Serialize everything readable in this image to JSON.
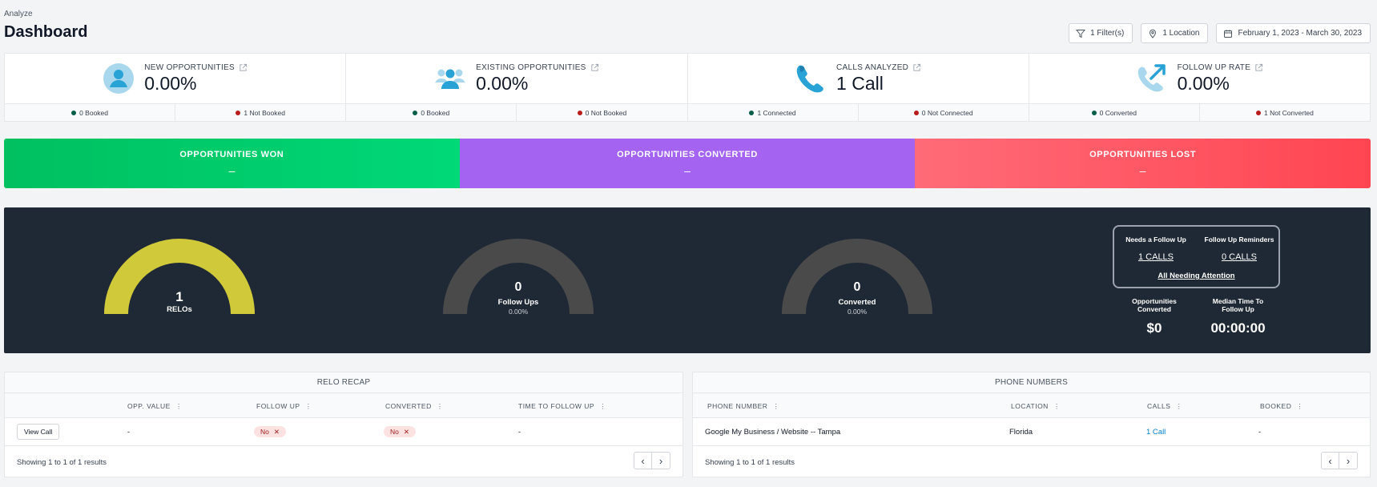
{
  "header": {
    "breadcrumb": "Analyze",
    "title": "Dashboard",
    "filters": [
      {
        "label": "1 Filter(s)",
        "icon": "filter-icon"
      },
      {
        "label": "1 Location",
        "icon": "map-pin-icon"
      },
      {
        "label": "February 1, 2023 - March 30, 2023",
        "icon": "calendar-icon"
      }
    ]
  },
  "stats": [
    {
      "label": "NEW OPPORTUNITIES",
      "value": "0.00%",
      "icon": "user-icon",
      "left": "0 Booked",
      "right": "1 Not Booked"
    },
    {
      "label": "EXISTING OPPORTUNITIES",
      "value": "0.00%",
      "icon": "users-icon",
      "left": "0 Booked",
      "right": "0 Not Booked"
    },
    {
      "label": "CALLS ANALYZED",
      "value": "1 Call",
      "icon": "phone-icon",
      "left": "1 Connected",
      "right": "0 Not Connected"
    },
    {
      "label": "FOLLOW UP RATE",
      "value": "0.00%",
      "icon": "phone-outgoing-icon",
      "left": "0 Converted",
      "right": "1 Not Converted"
    }
  ],
  "banners": {
    "won": {
      "title": "OPPORTUNITIES WON",
      "value": "–"
    },
    "converted": {
      "title": "OPPORTUNITIES CONVERTED",
      "value": "–"
    },
    "lost": {
      "title": "OPPORTUNITIES LOST",
      "value": "–"
    }
  },
  "gauges": {
    "relos": {
      "value": "1",
      "label": "RELOs",
      "fill": 1.0,
      "color": "#d0c93a"
    },
    "followups": {
      "value": "0",
      "label": "Follow Ups",
      "pct": "0.00%",
      "fill": 0.0,
      "color": "#4a4a4a"
    },
    "converted": {
      "value": "0",
      "label": "Converted",
      "pct": "0.00%",
      "fill": 0.0,
      "color": "#4a4a4a"
    }
  },
  "follow_box": {
    "needs_label": "Needs a Follow Up",
    "needs_value": "1 CALLS",
    "reminders_label": "Follow Up Reminders",
    "reminders_value": "0 CALLS",
    "all_link": "All Needing Attention"
  },
  "metrics": {
    "opps_converted_label_1": "Opportunities",
    "opps_converted_label_2": "Converted",
    "opps_converted_value": "$0",
    "median_label_1": "Median Time To",
    "median_label_2": "Follow Up",
    "median_value": "00:00:00"
  },
  "relo_recap": {
    "title": "RELO RECAP",
    "columns": [
      "OPP. VALUE",
      "FOLLOW UP",
      "CONVERTED",
      "TIME TO FOLLOW UP"
    ],
    "row": {
      "button": "View Call",
      "opp_value": "-",
      "follow_up": "No",
      "converted": "No",
      "time": "-"
    },
    "showing": "Showing 1 to 1 of 1 results"
  },
  "phone_numbers": {
    "title": "PHONE NUMBERS",
    "columns": [
      "PHONE NUMBER",
      "LOCATION",
      "CALLS",
      "BOOKED"
    ],
    "row": {
      "phone": "Google My Business / Website -- Tampa",
      "location": "Florida",
      "calls": "1 Call",
      "booked": "-"
    },
    "showing": "Showing 1 to 1 of 1 results"
  },
  "pager": {
    "prev": "‹",
    "next": "›"
  },
  "colors": {
    "accent": "#29a3d6",
    "dark_panel": "#1f2935",
    "won": "#00c96a",
    "converted": "#a463f0",
    "lost": "#ff5a64"
  }
}
